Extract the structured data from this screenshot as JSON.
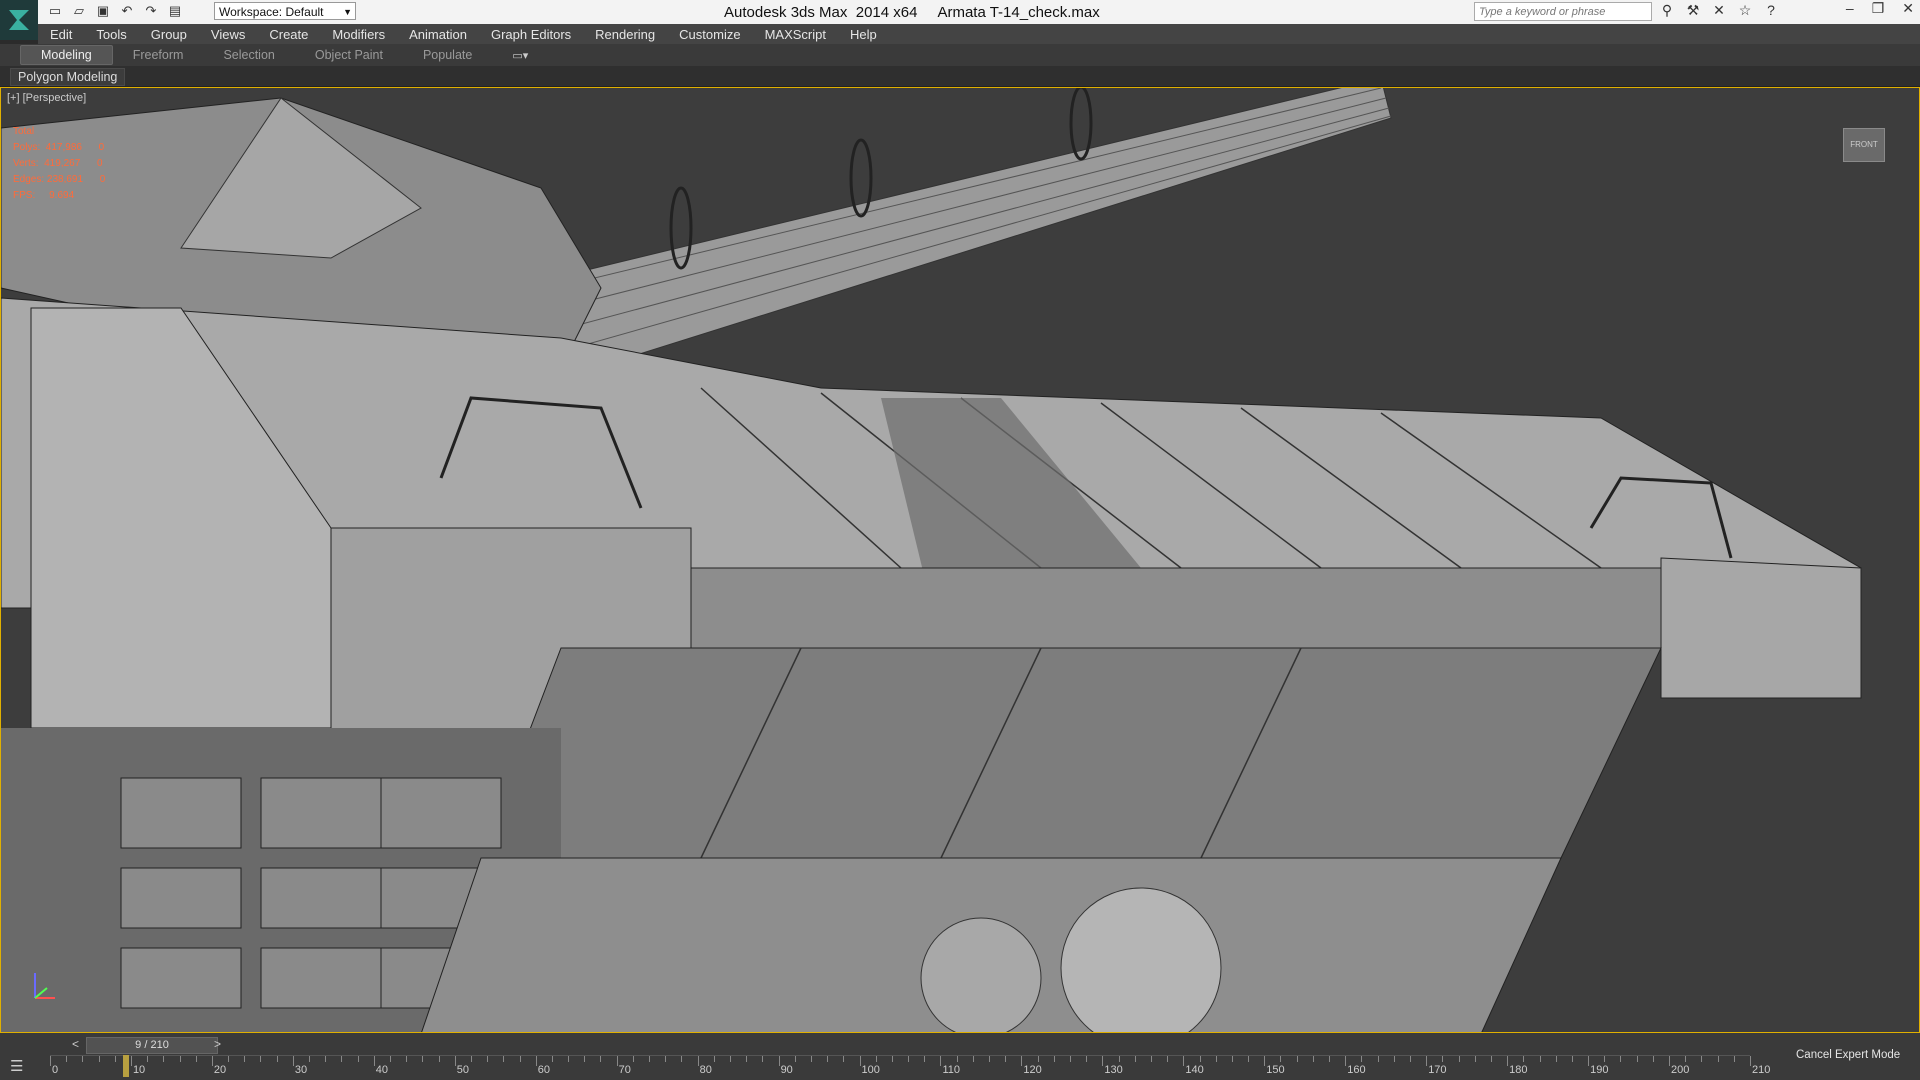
{
  "window": {
    "title": "Autodesk 3ds Max  2014 x64     Armata T-14_check.max",
    "search_placeholder": "Type a keyword or phrase"
  },
  "quick_access": {
    "workspace_label": "Workspace: Default",
    "icons": [
      "new-file-icon",
      "open-file-icon",
      "save-icon",
      "undo-icon",
      "redo-icon",
      "project-folder-icon"
    ]
  },
  "window_controls": {
    "minimize": "–",
    "maximize": "❐",
    "close": "✕"
  },
  "help_icons": [
    "binoculars-icon",
    "wrench-icon",
    "x-icon",
    "star-icon",
    "help-icon"
  ],
  "menu": [
    "Edit",
    "Tools",
    "Group",
    "Views",
    "Create",
    "Modifiers",
    "Animation",
    "Graph Editors",
    "Rendering",
    "Customize",
    "MAXScript",
    "Help"
  ],
  "ribbon": {
    "tabs": [
      "Modeling",
      "Freeform",
      "Selection",
      "Object Paint",
      "Populate"
    ],
    "active_tab": "Modeling",
    "panel_label": "Polygon Modeling"
  },
  "viewport": {
    "label": "[+] [Perspective]",
    "stats": [
      "Total",
      "Polys:  417,986      0",
      "Verts:  419,267      0",
      "Edges: 238,691      0",
      "",
      "FPS:     9.694"
    ],
    "viewcube_label": "FRONT"
  },
  "timeline": {
    "frame_display": "9 / 210",
    "current_frame": 9,
    "total_frames": 210,
    "ticks": [
      0,
      10,
      20,
      30,
      40,
      50,
      60,
      70,
      80,
      90,
      100,
      110,
      120,
      130,
      140,
      150,
      160,
      170,
      180,
      190,
      200,
      210
    ],
    "expert_mode_label": "Cancel Expert Mode"
  },
  "colors": {
    "viewport_bg": "#3d3d3d",
    "active_border": "#e0b000",
    "stats_text": "#ff6b3a"
  }
}
